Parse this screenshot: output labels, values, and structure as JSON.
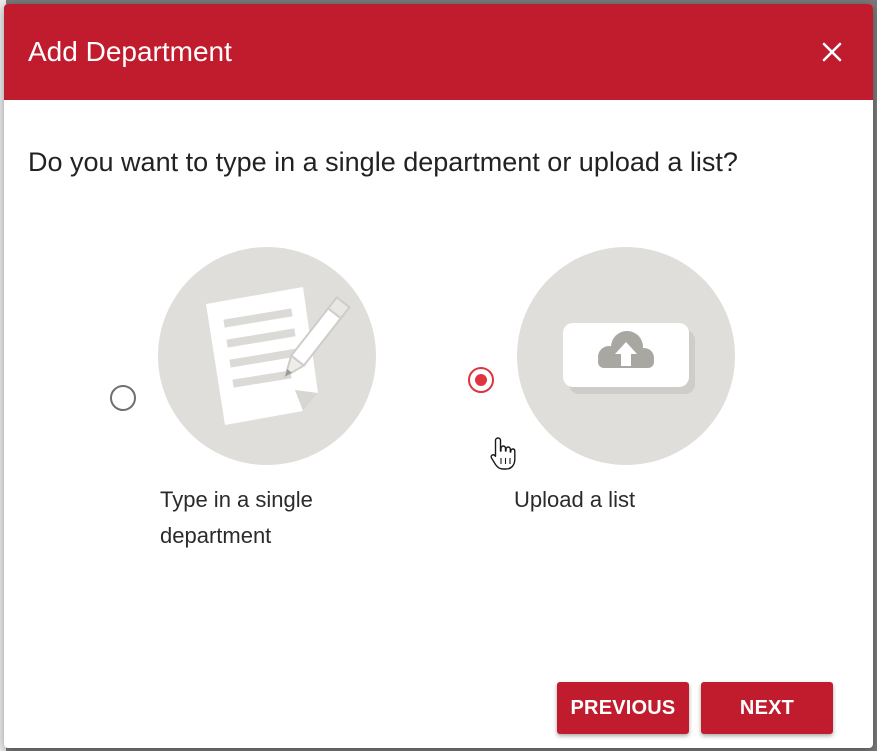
{
  "dialog": {
    "title": "Add Department",
    "question": "Do you want to type in a single department or upload a list?"
  },
  "options": [
    {
      "label": "Type in a single department",
      "selected": false,
      "icon": "document-pencil-icon"
    },
    {
      "label": "Upload a list",
      "selected": true,
      "icon": "cloud-upload-icon"
    }
  ],
  "buttons": {
    "previous_label": "PREVIOUS",
    "next_label": "NEXT"
  },
  "colors": {
    "brand": "#c01c2e",
    "radio_selected": "#e0353f",
    "illustration_bg": "#dfdedb"
  }
}
